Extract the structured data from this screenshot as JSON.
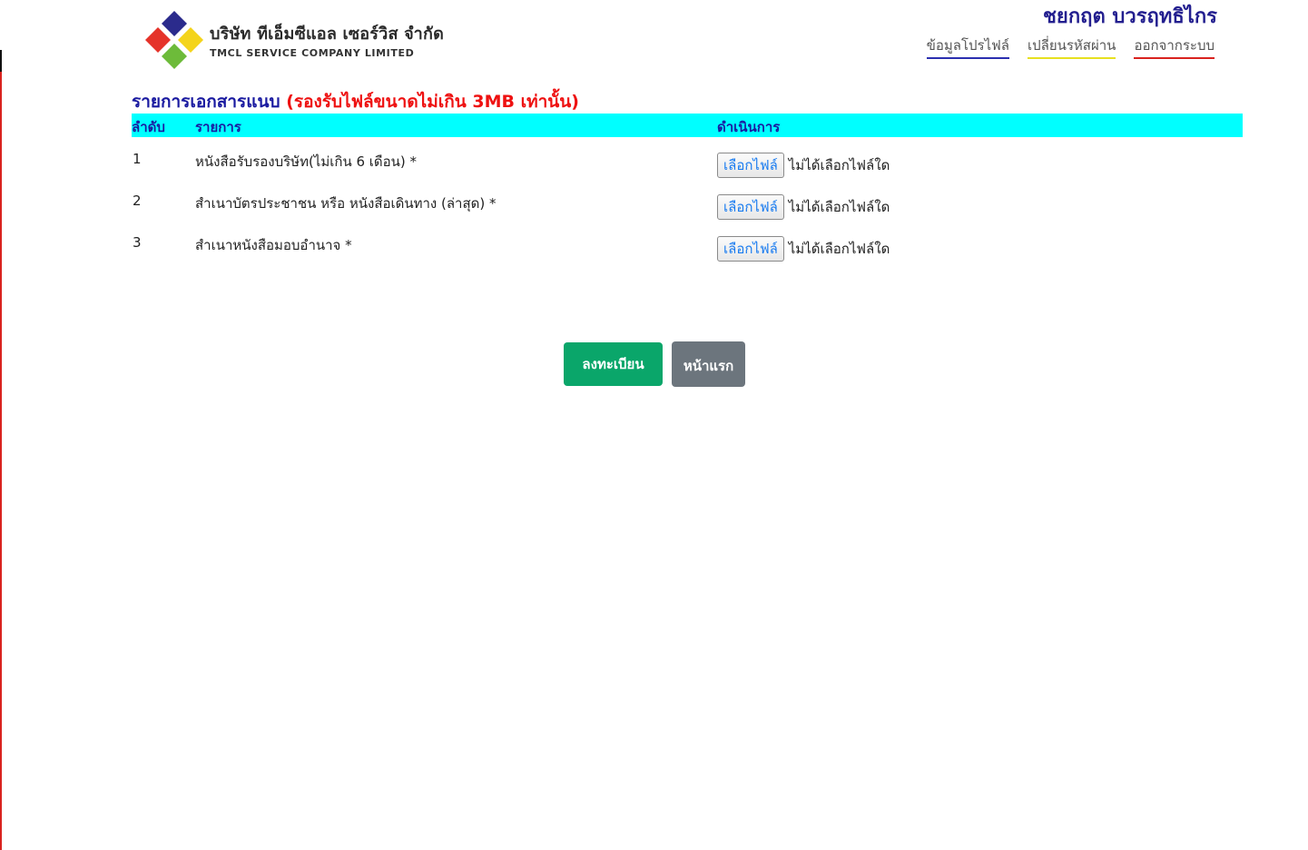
{
  "brand": {
    "name_th": "บริษัท ทีเอ็มซีแอล เซอร์วิส จำกัด",
    "name_en": "TMCL SERVICE COMPANY LIMITED",
    "colors": [
      "#2b2b8c",
      "#e5332a",
      "#f4d41b",
      "#6dbb3a"
    ]
  },
  "header": {
    "user_name": "ชยกฤต บวรฤทธิไกร",
    "links": {
      "profile": "ข้อมูลโปรไฟล์",
      "change_password": "เปลี่ยนรหัสผ่าน",
      "logout": "ออกจากระบบ"
    }
  },
  "attachments": {
    "title": "รายการเอกสารแนบ",
    "note": "(รองรับไฟล์ขนาดไม่เกิน 3MB เท่านั้น)",
    "columns": {
      "no": "ลำดับ",
      "item": "รายการ",
      "action": "ดำเนินการ"
    },
    "rows": [
      {
        "no": "1",
        "item": "หนังสือรับรองบริษัท(ไม่เกิน 6 เดือน) *",
        "button": "เลือกไฟล์",
        "status": "ไม่ได้เลือกไฟล์ใด"
      },
      {
        "no": "2",
        "item": "สำเนาบัตรประชาชน หรือ หนังสือเดินทาง (ล่าสุด) *",
        "button": "เลือกไฟล์",
        "status": "ไม่ได้เลือกไฟล์ใด"
      },
      {
        "no": "3",
        "item": "สำเนาหนังสือมอบอำนาจ *",
        "button": "เลือกไฟล์",
        "status": "ไม่ได้เลือกไฟล์ใด"
      }
    ]
  },
  "actions": {
    "register": "ลงทะเบียน",
    "home": "หน้าแรก"
  },
  "colors": {
    "header_bg": "#00ffff",
    "title_blue": "#1a1aa0",
    "note_red": "#ee1111",
    "user_name": "#231f8f",
    "register_btn": "#0aa66a",
    "home_btn": "#6c757d"
  }
}
